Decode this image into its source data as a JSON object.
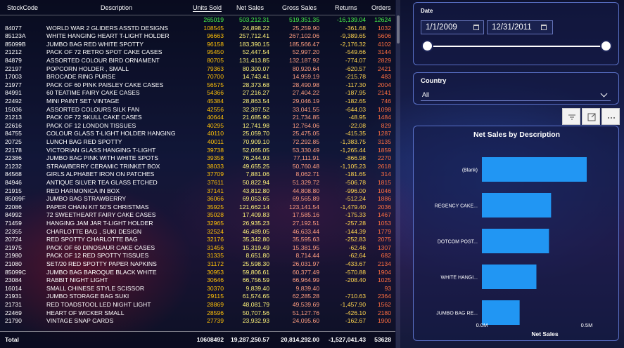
{
  "table": {
    "columns": {
      "code": "StockCode",
      "desc": "Description",
      "units": "Units Sold",
      "net": "Net Sales",
      "gross": "Gross Sales",
      "returns": "Returns",
      "orders": "Orders"
    },
    "totals_top": {
      "units": "265019",
      "net": "503,212.31",
      "gross": "519,351.35",
      "returns": "-16,139.04",
      "orders": "12624"
    },
    "rows": [
      {
        "code": "84077",
        "desc": "WORLD WAR 2 GLIDERS ASSTD DESIGNS",
        "units": "108545",
        "net": "24,898.22",
        "gross": "25,259.90",
        "returns": "-361.68",
        "orders": "1032"
      },
      {
        "code": "85123A",
        "desc": "WHITE HANGING HEART T-LIGHT HOLDER",
        "units": "96663",
        "net": "257,712.41",
        "gross": "267,102.06",
        "returns": "-9,389.65",
        "orders": "5606"
      },
      {
        "code": "85099B",
        "desc": "JUMBO BAG RED WHITE SPOTTY",
        "units": "96158",
        "net": "183,390.15",
        "gross": "185,566.47",
        "returns": "-2,176.32",
        "orders": "4102"
      },
      {
        "code": "21212",
        "desc": "PACK OF 72 RETRO SPOT CAKE CASES",
        "units": "95450",
        "net": "52,447.54",
        "gross": "52,997.20",
        "returns": "-549.66",
        "orders": "3144"
      },
      {
        "code": "84879",
        "desc": "ASSORTED COLOUR BIRD ORNAMENT",
        "units": "80705",
        "net": "131,413.85",
        "gross": "132,187.92",
        "returns": "-774.07",
        "orders": "2829"
      },
      {
        "code": "22197",
        "desc": "POPCORN HOLDER , SMALL",
        "units": "79363",
        "net": "80,300.07",
        "gross": "80,920.64",
        "returns": "-620.57",
        "orders": "2421"
      },
      {
        "code": "17003",
        "desc": "BROCADE RING PURSE",
        "units": "70700",
        "net": "14,743.41",
        "gross": "14,959.19",
        "returns": "-215.78",
        "orders": "483"
      },
      {
        "code": "21977",
        "desc": "PACK OF 60 PINK PAISLEY CAKE CASES",
        "units": "56575",
        "net": "28,373.68",
        "gross": "28,490.98",
        "returns": "-117.30",
        "orders": "2004"
      },
      {
        "code": "84991",
        "desc": "60 TEATIME FAIRY CAKE CASES",
        "units": "54366",
        "net": "27,216.27",
        "gross": "27,404.22",
        "returns": "-187.95",
        "orders": "2141"
      },
      {
        "code": "22492",
        "desc": "MINI PAINT SET VINTAGE",
        "units": "45384",
        "net": "28,863.54",
        "gross": "29,046.19",
        "returns": "-182.65",
        "orders": "746"
      },
      {
        "code": "15036",
        "desc": "ASSORTED COLOURS SILK FAN",
        "units": "42556",
        "net": "32,397.52",
        "gross": "33,041.55",
        "returns": "-644.03",
        "orders": "1098"
      },
      {
        "code": "21213",
        "desc": "PACK OF 72 SKULL CAKE CASES",
        "units": "40644",
        "net": "21,685.90",
        "gross": "21,734.85",
        "returns": "-48.95",
        "orders": "1484"
      },
      {
        "code": "22616",
        "desc": "PACK OF 12 LONDON TISSUES",
        "units": "40295",
        "net": "12,741.98",
        "gross": "12,764.06",
        "returns": "-22.08",
        "orders": "829"
      },
      {
        "code": "84755",
        "desc": "COLOUR GLASS T-LIGHT HOLDER HANGING",
        "units": "40110",
        "net": "25,059.70",
        "gross": "25,475.05",
        "returns": "-415.35",
        "orders": "1287"
      },
      {
        "code": "20725",
        "desc": "LUNCH BAG RED SPOTTY",
        "units": "40011",
        "net": "70,909.10",
        "gross": "72,292.85",
        "returns": "-1,383.75",
        "orders": "3135"
      },
      {
        "code": "22178",
        "desc": "VICTORIAN GLASS HANGING T-LIGHT",
        "units": "39738",
        "net": "52,065.05",
        "gross": "53,330.49",
        "returns": "-1,265.44",
        "orders": "1859"
      },
      {
        "code": "22386",
        "desc": "JUMBO BAG PINK WITH WHITE SPOTS",
        "units": "39358",
        "net": "76,244.93",
        "gross": "77,111.91",
        "returns": "-866.98",
        "orders": "2270"
      },
      {
        "code": "21232",
        "desc": "STRAWBERRY CERAMIC TRINKET BOX",
        "units": "38033",
        "net": "49,655.25",
        "gross": "50,760.48",
        "returns": "-1,105.23",
        "orders": "2618"
      },
      {
        "code": "84568",
        "desc": "GIRLS ALPHABET IRON ON PATCHES",
        "units": "37709",
        "net": "7,881.06",
        "gross": "8,062.71",
        "returns": "-181.65",
        "orders": "314"
      },
      {
        "code": "84946",
        "desc": "ANTIQUE SILVER TEA GLASS ETCHED",
        "units": "37611",
        "net": "50,822.94",
        "gross": "51,329.72",
        "returns": "-506.78",
        "orders": "1815"
      },
      {
        "code": "21915",
        "desc": "RED HARMONICA IN BOX",
        "units": "37141",
        "net": "43,812.80",
        "gross": "44,808.80",
        "returns": "-996.00",
        "orders": "1046"
      },
      {
        "code": "85099F",
        "desc": "JUMBO BAG STRAWBERRY",
        "units": "36066",
        "net": "69,053.65",
        "gross": "69,565.89",
        "returns": "-512.24",
        "orders": "1886"
      },
      {
        "code": "22086",
        "desc": "PAPER CHAIN KIT 50'S CHRISTMAS",
        "units": "35925",
        "net": "121,662.14",
        "gross": "123,141.54",
        "returns": "-1,479.40",
        "orders": "2036"
      },
      {
        "code": "84992",
        "desc": "72 SWEETHEART FAIRY CAKE CASES",
        "units": "35028",
        "net": "17,409.83",
        "gross": "17,585.16",
        "returns": "-175.33",
        "orders": "1467"
      },
      {
        "code": "71459",
        "desc": "HANGING JAM JAR T-LIGHT HOLDER",
        "units": "32965",
        "net": "26,935.23",
        "gross": "27,192.51",
        "returns": "-257.28",
        "orders": "1053"
      },
      {
        "code": "22355",
        "desc": "CHARLOTTE BAG , SUKI DESIGN",
        "units": "32524",
        "net": "46,489.05",
        "gross": "46,633.44",
        "returns": "-144.39",
        "orders": "1779"
      },
      {
        "code": "20724",
        "desc": "RED SPOTTY CHARLOTTE BAG",
        "units": "32176",
        "net": "35,342.80",
        "gross": "35,595.63",
        "returns": "-252.83",
        "orders": "2075"
      },
      {
        "code": "21975",
        "desc": "PACK OF 60 DINOSAUR CAKE CASES",
        "units": "31456",
        "net": "15,319.49",
        "gross": "15,381.95",
        "returns": "-62.46",
        "orders": "1307"
      },
      {
        "code": "21980",
        "desc": "PACK OF 12 RED SPOTTY TISSUES",
        "units": "31335",
        "net": "8,651.80",
        "gross": "8,714.44",
        "returns": "-62.64",
        "orders": "682"
      },
      {
        "code": "21080",
        "desc": "SET/20 RED SPOTTY PAPER NAPKINS",
        "units": "31172",
        "net": "25,598.30",
        "gross": "26,031.97",
        "returns": "-433.67",
        "orders": "2134"
      },
      {
        "code": "85099C",
        "desc": "JUMBO BAG BAROQUE BLACK WHITE",
        "units": "30953",
        "net": "59,806.61",
        "gross": "60,377.49",
        "returns": "-570.88",
        "orders": "1904"
      },
      {
        "code": "23084",
        "desc": "RABBIT NIGHT LIGHT",
        "units": "30646",
        "net": "66,756.59",
        "gross": "66,964.99",
        "returns": "-208.40",
        "orders": "1025"
      },
      {
        "code": "16014",
        "desc": "SMALL CHINESE STYLE SCISSOR",
        "units": "30370",
        "net": "9,839.40",
        "gross": "9,839.40",
        "returns": "",
        "orders": "93"
      },
      {
        "code": "21931",
        "desc": "JUMBO STORAGE BAG SUKI",
        "units": "29115",
        "net": "61,574.65",
        "gross": "62,285.28",
        "returns": "-710.63",
        "orders": "2364"
      },
      {
        "code": "21731",
        "desc": "RED TOADSTOOL LED NIGHT LIGHT",
        "units": "28869",
        "net": "48,081.79",
        "gross": "49,539.69",
        "returns": "-1,457.90",
        "orders": "1562"
      },
      {
        "code": "22469",
        "desc": "HEART OF WICKER SMALL",
        "units": "28596",
        "net": "50,707.56",
        "gross": "51,127.76",
        "returns": "-426.10",
        "orders": "2180"
      },
      {
        "code": "21790",
        "desc": "VINTAGE SNAP CARDS",
        "units": "27739",
        "net": "23,932.93",
        "gross": "24,095.60",
        "returns": "-162.67",
        "orders": "1900"
      }
    ],
    "footer": {
      "label": "Total",
      "units": "10608492",
      "net": "19,287,250.57",
      "gross": "20,814,292.00",
      "returns": "-1,527,041.43",
      "orders": "53628"
    }
  },
  "date_filter": {
    "title": "Date",
    "start": "1/1/2009",
    "end": "12/31/2011",
    "start_icon": "calendar-icon",
    "end_icon": "calendar-icon"
  },
  "country_filter": {
    "title": "Country",
    "value": "All"
  },
  "toolbar": {
    "icons": [
      "filter-icon",
      "focus-mode-icon",
      "more-options-icon"
    ]
  },
  "chart_data": {
    "type": "bar",
    "orientation": "horizontal",
    "title": "Net Sales by Description",
    "xlabel": "Net Sales",
    "ylabel": "",
    "categories": [
      "(Blank)",
      "REGENCY CAKE...",
      "DOTCOM POST...",
      "WHITE HANGI...",
      "JUMBO BAG RE..."
    ],
    "values": [
      0.5,
      0.33,
      0.32,
      0.26,
      0.18
    ],
    "unit": "M",
    "xlim": [
      0,
      0.5
    ],
    "xticks": [
      "0.0M",
      "0.5M"
    ],
    "color": "#2196f3"
  }
}
